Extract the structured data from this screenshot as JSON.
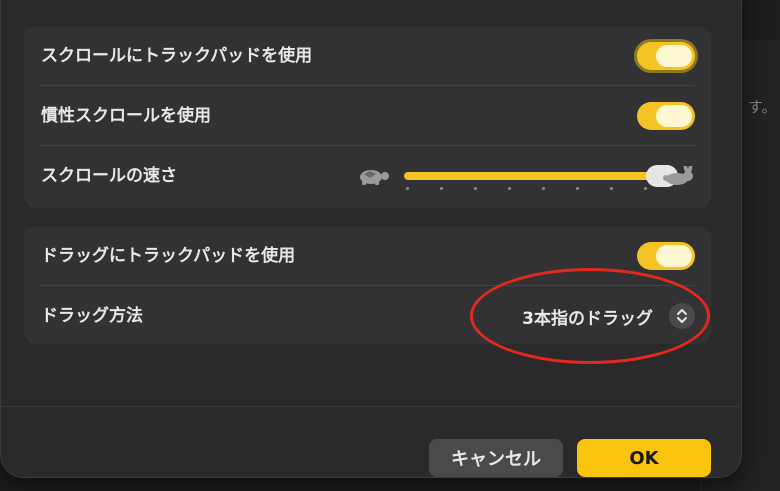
{
  "background": {
    "partial_text": "す。"
  },
  "scroll_group": {
    "rows": [
      {
        "label": "スクロールにトラックパッドを使用",
        "toggle_on": true
      },
      {
        "label": "慣性スクロールを使用",
        "toggle_on": true
      },
      {
        "label": "スクロールの速さ"
      }
    ],
    "speed_slider": {
      "value_fraction": 0.95,
      "min_icon": "turtle-icon",
      "max_icon": "rabbit-icon",
      "tick_count": 8
    }
  },
  "drag_group": {
    "rows": [
      {
        "label": "ドラッグにトラックパッドを使用",
        "toggle_on": true
      },
      {
        "label": "ドラッグ方法",
        "value": "3本指のドラッグ"
      }
    ]
  },
  "footer": {
    "cancel_label": "キャンセル",
    "ok_label": "OK"
  },
  "colors": {
    "accent": "#f6c324",
    "ok_button": "#fbc40c",
    "annotation": "#e5281c"
  }
}
